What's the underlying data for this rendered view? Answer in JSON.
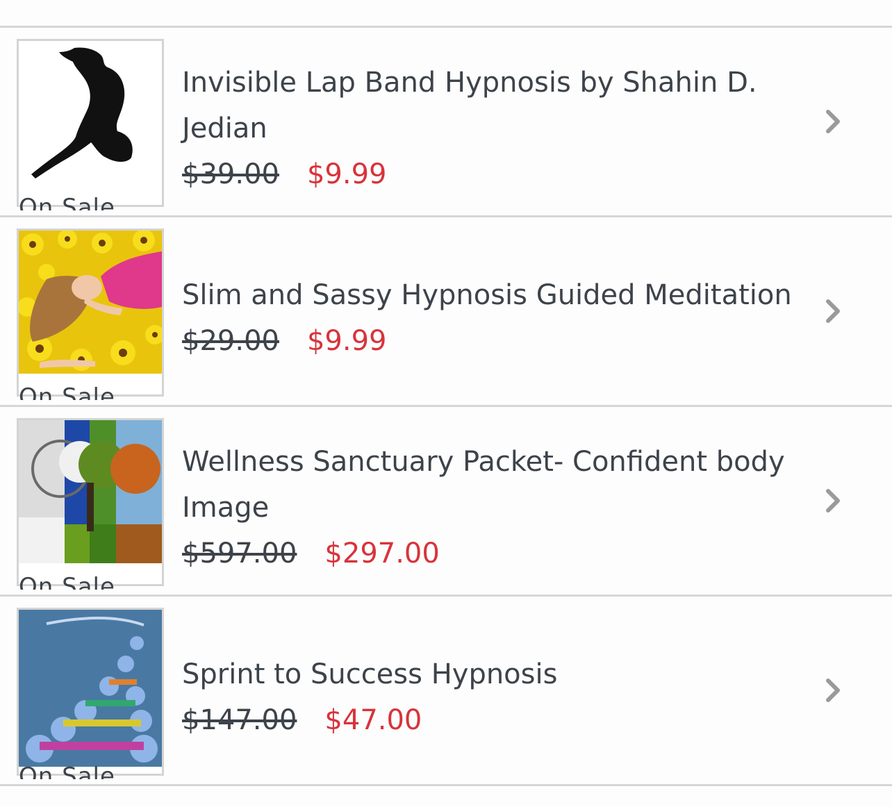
{
  "products": [
    {
      "title": "Invisible Lap Band Hypnosis by Shahin D. Jedian",
      "old_price": "$39.00",
      "new_price": "$9.99",
      "tag": "On Sale",
      "image": "dancer-silhouette"
    },
    {
      "title": "Slim and Sassy Hypnosis Guided Meditation",
      "old_price": "$29.00",
      "new_price": "$9.99",
      "tag": "On Sale",
      "image": "woman-in-sunflowers"
    },
    {
      "title": "Wellness Sanctuary Packet- Confident body Image",
      "old_price": "$597.00",
      "new_price": "$297.00",
      "tag": "On Sale",
      "image": "four-seasons-tree"
    },
    {
      "title": "Sprint to Success Hypnosis",
      "old_price": "$147.00",
      "new_price": "$47.00",
      "tag": "On Sale",
      "image": "dna-helix"
    }
  ],
  "colors": {
    "sale_price": "#d8333b",
    "text": "#3d434a",
    "divider": "#d6d6d6",
    "chevron": "#9a9a9a"
  }
}
